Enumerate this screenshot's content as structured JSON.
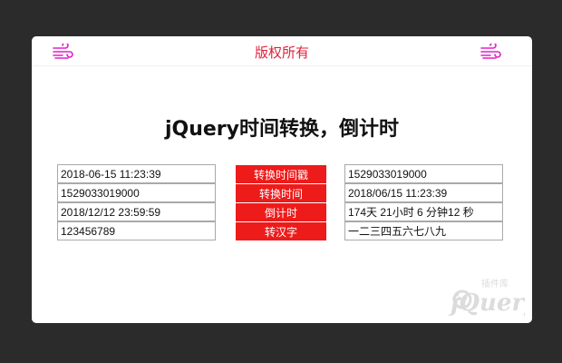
{
  "header": {
    "title": "版权所有",
    "accent_color": "#e0213a",
    "icon_color": "#e020c8",
    "left_icon": "wind-icon",
    "right_icon": "wind-icon"
  },
  "main": {
    "title": "jQuery时间转换，倒计时",
    "button_color": "#ee1b1b",
    "rows": [
      {
        "input": "2018-06-15 11:23:39",
        "button": "转换时间戳",
        "output": "1529033019000"
      },
      {
        "input": "1529033019000",
        "button": "转换时间",
        "output": "2018/06/15 11:23:39"
      },
      {
        "input": "2018/12/12 23:59:59",
        "button": "倒计时",
        "output": "174天 21小时 6 分钟12 秒"
      },
      {
        "input": "123456789",
        "button": "转汉字",
        "output": "一二三四五六七八九"
      }
    ]
  },
  "watermark": {
    "brand": "jQuery",
    "subtitle": "插件库",
    "icon": "jquery-logo"
  }
}
